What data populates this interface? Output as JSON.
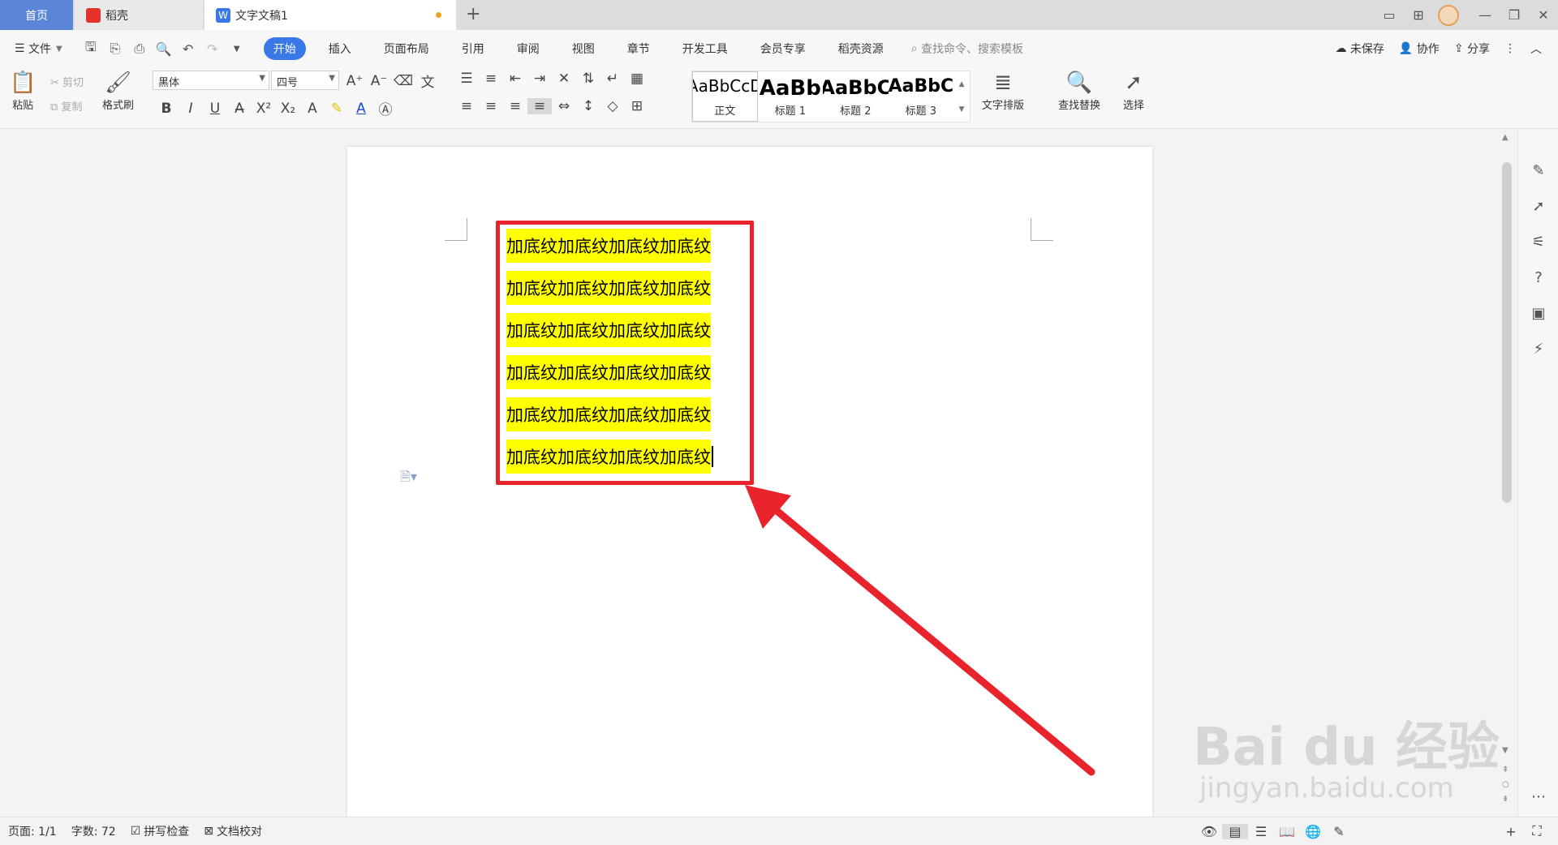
{
  "tabs": {
    "home": "首页",
    "daoke": "稻壳",
    "doc": "文字文稿1",
    "new_tab": "+"
  },
  "menu": {
    "file": "文件",
    "items": [
      "开始",
      "插入",
      "页面布局",
      "引用",
      "审阅",
      "视图",
      "章节",
      "开发工具",
      "会员专享",
      "稻壳资源"
    ],
    "search_placeholder": "查找命令、搜索模板",
    "unsaved": "未保存",
    "collab": "协作",
    "share": "分享"
  },
  "ribbon": {
    "paste": "粘贴",
    "cut": "剪切",
    "copy": "复制",
    "format_painter": "格式刷",
    "font": "黑体",
    "size": "四号",
    "styles": [
      {
        "preview": "AaBbCcD",
        "name": "正文"
      },
      {
        "preview": "AaBb",
        "name": "标题 1"
      },
      {
        "preview": "AaBbC",
        "name": "标题 2"
      },
      {
        "preview": "AaBbC",
        "name": "标题 3"
      }
    ],
    "text_layout": "文字排版",
    "find_replace": "查找替换",
    "select": "选择"
  },
  "document": {
    "lines": [
      "加底纹加底纹加底纹加底纹",
      "加底纹加底纹加底纹加底纹",
      "加底纹加底纹加底纹加底纹",
      "加底纹加底纹加底纹加底纹",
      "加底纹加底纹加底纹加底纹",
      "加底纹加底纹加底纹加底纹"
    ],
    "highlight_color": "#ffff00",
    "annotation_color": "#e8232b"
  },
  "status": {
    "page": "页面: 1/1",
    "words": "字数: 72",
    "spellcheck": "拼写检查",
    "proofread": "文档校对"
  },
  "watermark": {
    "brand": "Bai du 经验",
    "url": "jingyan.baidu.com"
  }
}
